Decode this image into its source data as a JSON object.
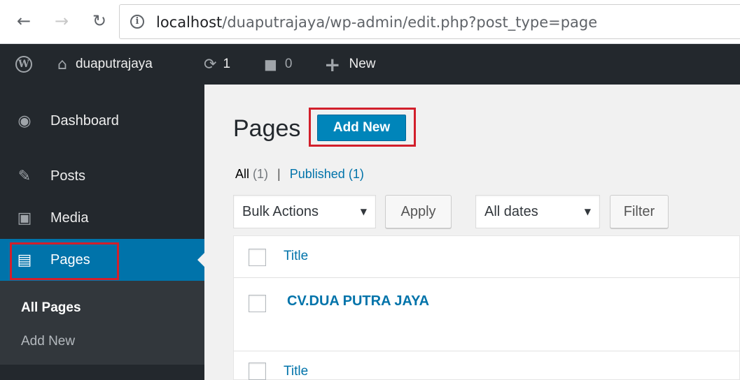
{
  "browser": {
    "url_host": "localhost",
    "url_path": "/duaputrajaya/wp-admin/edit.php?post_type=page",
    "icons": {
      "back": "arrow-left-icon",
      "forward": "arrow-right-icon",
      "reload": "reload-icon",
      "info": "info-icon"
    }
  },
  "admin_bar": {
    "site_name": "duaputrajaya",
    "updates_count": "1",
    "comments_count": "0",
    "new_label": "New"
  },
  "sidebar": {
    "items": [
      {
        "label": "Dashboard",
        "icon": "dashboard-icon"
      },
      {
        "label": "Posts",
        "icon": "pin-icon"
      },
      {
        "label": "Media",
        "icon": "media-icon"
      },
      {
        "label": "Pages",
        "icon": "pages-icon",
        "active": true
      }
    ],
    "submenu": [
      "All Pages",
      "Add New"
    ]
  },
  "main": {
    "heading": "Pages",
    "add_new_label": "Add New",
    "filters": {
      "all_label": "All",
      "all_count": "(1)",
      "separator": "|",
      "published_label": "Published",
      "published_count": "(1)"
    },
    "bulk_actions": "Bulk Actions",
    "apply_label": "Apply",
    "dates": "All dates",
    "filter_label": "Filter",
    "table": {
      "column_title": "Title",
      "rows": [
        {
          "title": "CV.DUA PUTRA JAYA"
        }
      ],
      "footer_title": "Title"
    }
  },
  "colors": {
    "admin_bar_bg": "#23282d",
    "active_menu_bg": "#0073aa",
    "primary_button": "#0085ba",
    "highlight_box": "#d21f2b",
    "link": "#0073aa"
  }
}
